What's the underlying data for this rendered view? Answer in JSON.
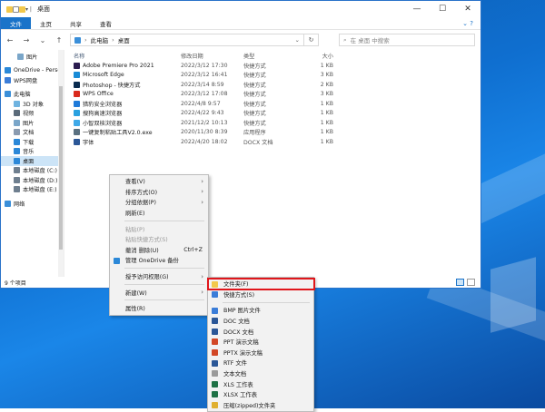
{
  "window": {
    "title": "桌面",
    "controls": [
      "—",
      "☐",
      "✕"
    ]
  },
  "ribbon": {
    "tabs": [
      "文件",
      "主页",
      "共享",
      "查看"
    ],
    "help": "?"
  },
  "address": {
    "path": [
      "此电脑",
      "桌面"
    ],
    "search_placeholder": "在 桌面 中搜索"
  },
  "sidebar": {
    "items": [
      {
        "label": "图片",
        "color": "#7aa6c9"
      },
      {
        "label": "OneDrive - Perso",
        "color": "#2b88d8"
      },
      {
        "label": "WPS网盘",
        "color": "#3b7dd8"
      },
      {
        "label": "此电脑",
        "color": "#3b8fd9"
      },
      {
        "label": "3D 对象",
        "color": "#6fb3e0"
      },
      {
        "label": "视频",
        "color": "#5b6b7a"
      },
      {
        "label": "图片",
        "color": "#7aa6c9"
      },
      {
        "label": "文档",
        "color": "#8a9bb0"
      },
      {
        "label": "下载",
        "color": "#2b88d8"
      },
      {
        "label": "音乐",
        "color": "#2b88d8"
      },
      {
        "label": "桌面",
        "color": "#2b88d8"
      },
      {
        "label": "本地磁盘 (C:)",
        "color": "#6f7f8f"
      },
      {
        "label": "本地磁盘 (D:)",
        "color": "#6f7f8f"
      },
      {
        "label": "本地磁盘 (E:)",
        "color": "#6f7f8f"
      },
      {
        "label": "网络",
        "color": "#3b8fd9"
      }
    ]
  },
  "columns": {
    "name": "名称",
    "date": "修改日期",
    "type": "类型",
    "size": "大小"
  },
  "files": [
    {
      "name": "Adobe Premiere Pro 2021",
      "date": "2022/3/12 17:30",
      "type": "快捷方式",
      "size": "1 KB",
      "color": "#2b1c4f"
    },
    {
      "name": "Microsoft Edge",
      "date": "2022/3/12 16:41",
      "type": "快捷方式",
      "size": "3 KB",
      "color": "#1a8bd6"
    },
    {
      "name": "Photoshop - 快捷方式",
      "date": "2022/3/14 8:59",
      "type": "快捷方式",
      "size": "2 KB",
      "color": "#0a2b4f"
    },
    {
      "name": "WPS Office",
      "date": "2022/3/12 17:08",
      "type": "快捷方式",
      "size": "3 KB",
      "color": "#d9291c"
    },
    {
      "name": "猎豹安全浏览器",
      "date": "2022/4/8 9:57",
      "type": "快捷方式",
      "size": "1 KB",
      "color": "#1f7ad9"
    },
    {
      "name": "搜狗高速浏览器",
      "date": "2022/4/22 9:43",
      "type": "快捷方式",
      "size": "1 KB",
      "color": "#2aa1e0"
    },
    {
      "name": "小智双核浏览器",
      "date": "2021/12/2 10:13",
      "type": "快捷方式",
      "size": "1 KB",
      "color": "#3fa9e8"
    },
    {
      "name": "一键复制粘贴工具V2.0.exe",
      "date": "2020/11/30 8:39",
      "type": "应用程序",
      "size": "1 KB",
      "color": "#5a7080"
    },
    {
      "name": "字体",
      "date": "2022/4/20 18:02",
      "type": "DOCX 文档",
      "size": "1 KB",
      "color": "#2b5797"
    }
  ],
  "status": {
    "count": "9 个项目"
  },
  "context_menu": {
    "items": [
      {
        "label": "查看(V)",
        "submenu": true
      },
      {
        "label": "排序方式(O)",
        "submenu": true
      },
      {
        "label": "分组依据(P)",
        "submenu": true
      },
      {
        "label": "刷新(E)"
      },
      {
        "sep": true
      },
      {
        "label": "粘贴(P)",
        "disabled": true
      },
      {
        "label": "粘贴快捷方式(S)",
        "disabled": true
      },
      {
        "label": "撤消 删除(U)",
        "shortcut": "Ctrl+Z"
      },
      {
        "label": "管理 OneDrive 备份",
        "icon_color": "#2b88d8"
      },
      {
        "sep": true
      },
      {
        "label": "授予访问权限(G)",
        "submenu": true
      },
      {
        "sep": true
      },
      {
        "label": "新建(W)",
        "submenu": true
      },
      {
        "sep": true
      },
      {
        "label": "属性(R)"
      }
    ]
  },
  "new_submenu": {
    "items": [
      {
        "label": "文件夹(F)",
        "icon_color": "#f2c84b"
      },
      {
        "label": "快捷方式(S)",
        "icon_color": "#3b7dd8"
      },
      {
        "sep": true
      },
      {
        "label": "BMP 图片文件",
        "icon_color": "#3b7dd8"
      },
      {
        "label": "DOC 文档",
        "icon_color": "#2b5797"
      },
      {
        "label": "DOCX 文档",
        "icon_color": "#2b5797"
      },
      {
        "label": "PPT 演示文稿",
        "icon_color": "#d24726"
      },
      {
        "label": "PPTX 演示文稿",
        "icon_color": "#d24726"
      },
      {
        "label": "RTF 文件",
        "icon_color": "#2b5797"
      },
      {
        "label": "文本文档",
        "icon_color": "#9a9a9a"
      },
      {
        "label": "XLS 工作表",
        "icon_color": "#1e7145"
      },
      {
        "label": "XLSX 工作表",
        "icon_color": "#1e7145"
      },
      {
        "label": "压缩(zipped)文件夹",
        "icon_color": "#e0b030"
      }
    ]
  }
}
